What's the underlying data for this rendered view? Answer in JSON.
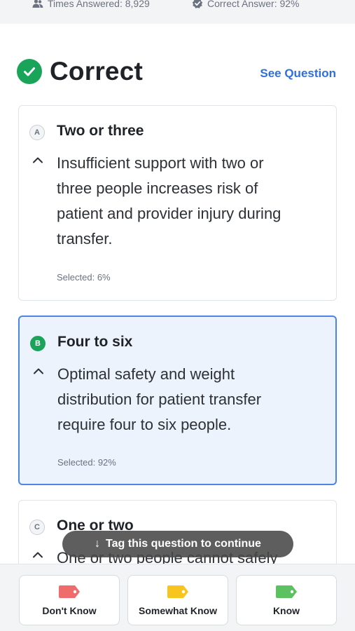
{
  "stats": {
    "times_answered": "Times Answered: 8,929",
    "correct_answer": "Correct Answer: 92%"
  },
  "result": {
    "title": "Correct",
    "see_question": "See Question",
    "status_color": "#1aa45a"
  },
  "options": [
    {
      "letter": "A",
      "title": "Two or three",
      "explanation_lines": [
        "Insufficient support with two or",
        "three people increases risk of",
        "patient and provider injury during",
        "transfer."
      ],
      "selected": "Selected: 6%",
      "state": "default"
    },
    {
      "letter": "B",
      "title": "Four to six",
      "explanation_lines": [
        "Optimal safety and weight",
        "distribution for patient transfer",
        "require four to six people."
      ],
      "selected": "Selected: 92%",
      "state": "correct"
    },
    {
      "letter": "C",
      "title": "One or two",
      "explanation_lines": [
        "One or two people cannot safely"
      ],
      "state": "default"
    }
  ],
  "toast": {
    "text": "Tag this question to continue",
    "icon": "arrow-down-icon"
  },
  "knowledge_buttons": [
    {
      "label": "Don't Know",
      "icon": "tag-icon",
      "color": "#f06b6b"
    },
    {
      "label": "Somewhat Know",
      "icon": "tag-icon",
      "color": "#f7c51e"
    },
    {
      "label": "Know",
      "icon": "tag-icon",
      "color": "#5cc261"
    }
  ],
  "colors": {
    "accent": "#2f6fdb",
    "selected_border": "#4a86e8",
    "selected_bg": "#edf3fd"
  }
}
